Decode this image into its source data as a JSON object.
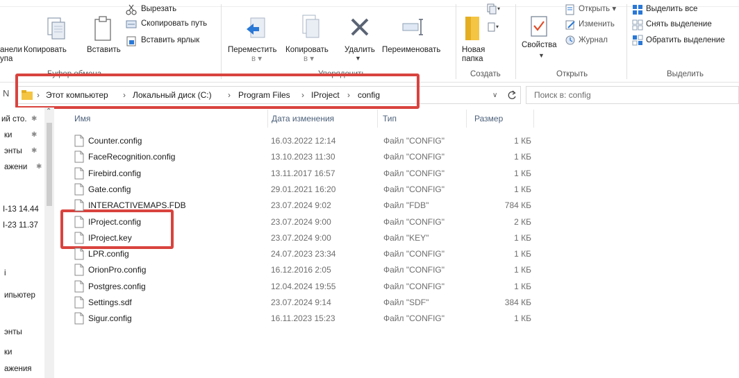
{
  "ribbon": {
    "clipboard": {
      "pin_label_line1": "анели",
      "pin_label_line2": "упа",
      "copy": "Копировать",
      "paste": "Вставить",
      "cut": "Вырезать",
      "copy_path": "Скопировать путь",
      "paste_shortcut": "Вставить ярлык",
      "group_label": "Буфер обмена"
    },
    "organize": {
      "move_line1": "Переместить",
      "move_line2": "в",
      "copy_line1": "Копировать",
      "copy_line2": "в",
      "delete": "Удалить",
      "rename": "Переименовать",
      "group_label": "Упорядочить"
    },
    "new": {
      "new_folder_line1": "Новая",
      "new_folder_line2": "папка",
      "group_label": "Создать"
    },
    "open": {
      "properties": "Свойства",
      "open": "Открыть",
      "edit": "Изменить",
      "history": "Журнал",
      "group_label": "Открыть"
    },
    "select": {
      "select_all": "Выделить все",
      "select_none": "Снять выделение",
      "invert": "Обратить выделение",
      "group_label": "Выделить"
    }
  },
  "address": {
    "crumbs": [
      "Этот компьютер",
      "Локальный диск (C:)",
      "Program Files",
      "IProject",
      "config"
    ],
    "search_placeholder": "Поиск в: config"
  },
  "nav": {
    "items": [
      "ий сто.",
      "ки",
      "энты",
      "ажени",
      "I-13 14.44",
      "I-23 11.37",
      "і",
      "ипьютер",
      "энты",
      "ки",
      "ажения"
    ]
  },
  "columns": {
    "name": "Имя",
    "date": "Дата изменения",
    "type": "Тип",
    "size": "Размер"
  },
  "files": [
    {
      "name": "Counter.config",
      "date": "16.03.2022 12:14",
      "type": "Файл \"CONFIG\"",
      "size": "1 КБ"
    },
    {
      "name": "FaceRecognition.config",
      "date": "13.10.2023 11:30",
      "type": "Файл \"CONFIG\"",
      "size": "1 КБ"
    },
    {
      "name": "Firebird.config",
      "date": "13.11.2017 16:57",
      "type": "Файл \"CONFIG\"",
      "size": "1 КБ"
    },
    {
      "name": "Gate.config",
      "date": "29.01.2021 16:20",
      "type": "Файл \"CONFIG\"",
      "size": "1 КБ"
    },
    {
      "name": "INTERACTIVEMAPS.FDB",
      "date": "23.07.2024 9:02",
      "type": "Файл \"FDB\"",
      "size": "784 КБ"
    },
    {
      "name": "IProject.config",
      "date": "23.07.2024 9:00",
      "type": "Файл \"CONFIG\"",
      "size": "2 КБ"
    },
    {
      "name": "IProject.key",
      "date": "23.07.2024 9:00",
      "type": "Файл \"KEY\"",
      "size": "1 КБ"
    },
    {
      "name": "LPR.config",
      "date": "24.07.2023 23:34",
      "type": "Файл \"CONFIG\"",
      "size": "1 КБ"
    },
    {
      "name": "OrionPro.config",
      "date": "16.12.2016 2:05",
      "type": "Файл \"CONFIG\"",
      "size": "1 КБ"
    },
    {
      "name": "Postgres.config",
      "date": "12.04.2024 19:55",
      "type": "Файл \"CONFIG\"",
      "size": "1 КБ"
    },
    {
      "name": "Settings.sdf",
      "date": "23.07.2024 9:14",
      "type": "Файл \"SDF\"",
      "size": "384 КБ"
    },
    {
      "name": "Sigur.config",
      "date": "16.11.2023 15:23",
      "type": "Файл \"CONFIG\"",
      "size": "1 КБ"
    }
  ],
  "colors": {
    "annotation_red": "#d9433e",
    "folder_yellow": "#f4c542",
    "accent_blue": "#2a78d6"
  },
  "icons": {
    "nav_back": "chevron-left-icon",
    "breadcrumb": "chevron-right-icon",
    "refresh": "refresh-icon",
    "dropdown": "chevron-down-icon",
    "file": "file-icon",
    "folder": "folder-icon"
  }
}
